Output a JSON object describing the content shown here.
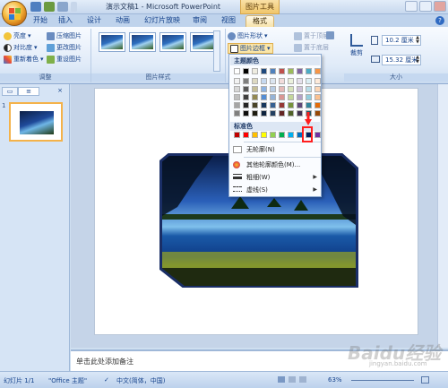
{
  "window": {
    "doc_title": "演示文稿1 - Microsoft PowerPoint",
    "tools_tab": "图片工具"
  },
  "tabs": [
    "开始",
    "插入",
    "设计",
    "动画",
    "幻灯片放映",
    "审阅",
    "视图",
    "格式"
  ],
  "ribbon": {
    "adjust": {
      "label": "调整",
      "brightness": "亮度",
      "contrast": "对比度",
      "recolor": "重新着色",
      "compress": "压缩图片",
      "change_picture": "更改图片",
      "reset_picture": "重设图片"
    },
    "picture_styles": {
      "label": "图片样式",
      "picture_shape": "图片形状",
      "picture_border": "图片边框"
    },
    "arrange": {
      "bring_front": "置于顶层",
      "send_back": "置于底层"
    },
    "size": {
      "label": "大小",
      "crop": "裁剪",
      "height": "10.2 厘米",
      "width": "15.32 厘米"
    }
  },
  "border_menu": {
    "theme_colors_header": "主题颜色",
    "standard_colors_header": "标准色",
    "no_outline": "无轮廓(N)",
    "more_colors": "其他轮廓颜色(M)...",
    "weight": "粗细(W)",
    "dashes": "虚线(S)",
    "theme_colors": [
      [
        "#ffffff",
        "#000000",
        "#eeece1",
        "#1f497d",
        "#4f81bd",
        "#c0504d",
        "#9bbb59",
        "#8064a2",
        "#4bacc6",
        "#f79646"
      ],
      [
        "#f2f2f2",
        "#7f7f7f",
        "#ddd9c3",
        "#c6d9f0",
        "#dbe5f1",
        "#f2dcdb",
        "#ebf1dd",
        "#e5e0ec",
        "#dbeef3",
        "#fdeada"
      ],
      [
        "#d8d8d8",
        "#595959",
        "#c4bd97",
        "#8db3e2",
        "#b8cce4",
        "#e5b9b7",
        "#d7e3bc",
        "#ccc1d9",
        "#b7dde8",
        "#fbd5b5"
      ],
      [
        "#bfbfbf",
        "#3f3f3f",
        "#938953",
        "#548dd4",
        "#95b3d7",
        "#d99694",
        "#c3d69b",
        "#b2a2c7",
        "#92cddc",
        "#fac08f"
      ],
      [
        "#a5a5a5",
        "#262626",
        "#494429",
        "#17365d",
        "#366092",
        "#953734",
        "#76923c",
        "#5f497a",
        "#31859b",
        "#e36c09"
      ],
      [
        "#7f7f7f",
        "#0c0c0c",
        "#1d1b10",
        "#0f243e",
        "#244061",
        "#632423",
        "#4f6128",
        "#3f3151",
        "#205867",
        "#974806"
      ]
    ],
    "standard_colors": [
      "#c00000",
      "#ff0000",
      "#ffc000",
      "#ffff00",
      "#92d050",
      "#00b050",
      "#00b0f0",
      "#0070c0",
      "#002060",
      "#7030a0"
    ]
  },
  "left_panel": {
    "slide_number": "1"
  },
  "notes": {
    "placeholder": "单击此处添加备注"
  },
  "status": {
    "slide_count": "幻灯片 1/1",
    "theme": "\"Office 主题\"",
    "language": "中文(简体，中国)",
    "zoom": "63%"
  },
  "watermark": {
    "brand": "Baidu经验",
    "url": "jingyan.baidu.com"
  }
}
